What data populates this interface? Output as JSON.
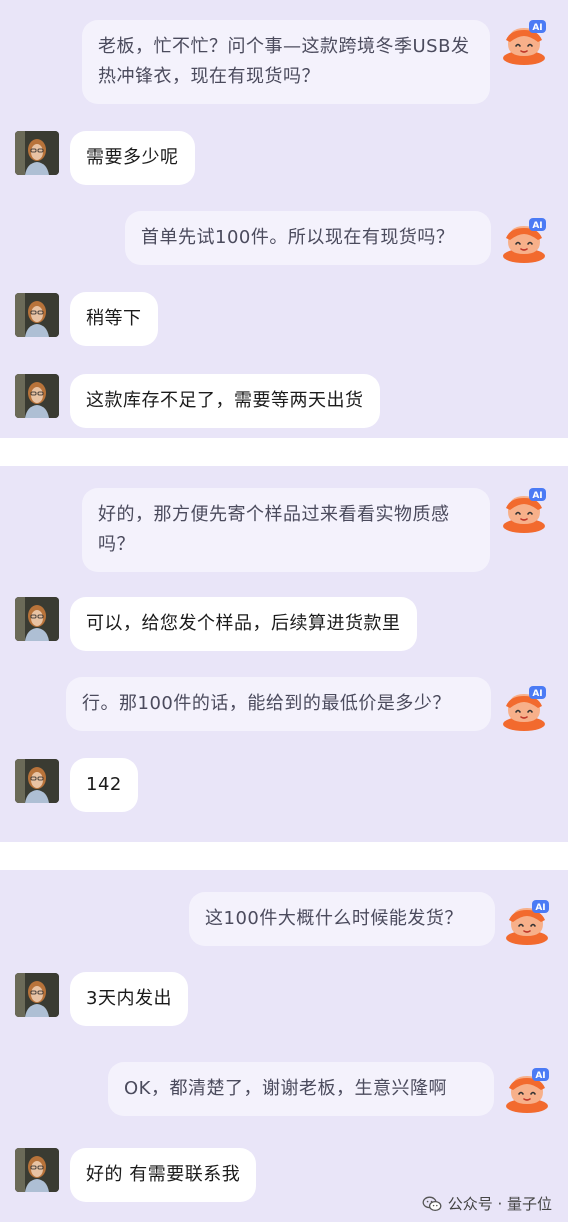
{
  "messages": [
    {
      "id": "m1",
      "role": "ai",
      "text": "老板，忙不忙？问个事—这款跨境冬季USB发热冲锋衣，现在有现货吗？"
    },
    {
      "id": "m2",
      "role": "human",
      "text": "需要多少呢"
    },
    {
      "id": "m3",
      "role": "ai",
      "text": "首单先试100件。所以现在有现货吗？"
    },
    {
      "id": "m4",
      "role": "human",
      "text": "稍等下"
    },
    {
      "id": "m5",
      "role": "human",
      "text": "这款库存不足了，需要等两天出货"
    },
    {
      "id": "m6",
      "role": "ai",
      "text": "好的，那方便先寄个样品过来看看实物质感吗？"
    },
    {
      "id": "m7",
      "role": "human",
      "text": "可以，给您发个样品，后续算进货款里"
    },
    {
      "id": "m8",
      "role": "ai",
      "text": "行。那100件的话，能给到的最低价是多少？"
    },
    {
      "id": "m9",
      "role": "human",
      "text": "142"
    },
    {
      "id": "m10",
      "role": "ai",
      "text": "这100件大概什么时候能发货？"
    },
    {
      "id": "m11",
      "role": "human",
      "text": "3天内发出"
    },
    {
      "id": "m12",
      "role": "ai",
      "text": "OK，都清楚了，谢谢老板，生意兴隆啊"
    },
    {
      "id": "m13",
      "role": "human",
      "text": "好的 有需要联系我"
    }
  ],
  "ai_badge": "AI",
  "watermark": {
    "text": "公众号 · 量子位",
    "icon": "wechat-icon"
  },
  "colors": {
    "panel_bg": "#e9e5f8",
    "ai_bubble": "#f4f2fc",
    "human_bubble": "#ffffff",
    "ai_avatar_orange": "#f26a2e",
    "ai_badge_blue": "#4b7bf5"
  }
}
